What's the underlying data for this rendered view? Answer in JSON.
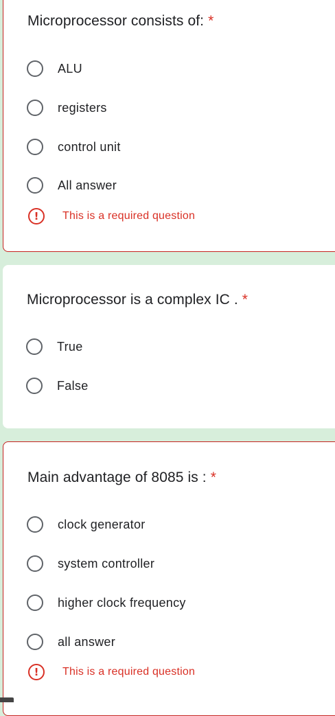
{
  "questions": [
    {
      "title": "Microprocessor consists of:",
      "required_mark": "*",
      "options": [
        "ALU",
        "registers",
        "control unit",
        "All answer"
      ],
      "error": {
        "icon": "alert-circle-icon",
        "text": "This is a required question"
      }
    },
    {
      "title": "Microprocessor is a complex IC .",
      "required_mark": "*",
      "options": [
        "True",
        "False"
      ]
    },
    {
      "title": "Main advantage of 8085 is :",
      "required_mark": "*",
      "options": [
        "clock generator",
        "system controller",
        "higher clock frequency",
        "all answer"
      ],
      "error": {
        "icon": "alert-circle-icon",
        "text": "This is a required question"
      }
    }
  ],
  "colors": {
    "page_background": "#d7eedb",
    "card_background": "#ffffff",
    "error": "#d93025",
    "radio_border": "#5f6368",
    "text": "#202124"
  }
}
